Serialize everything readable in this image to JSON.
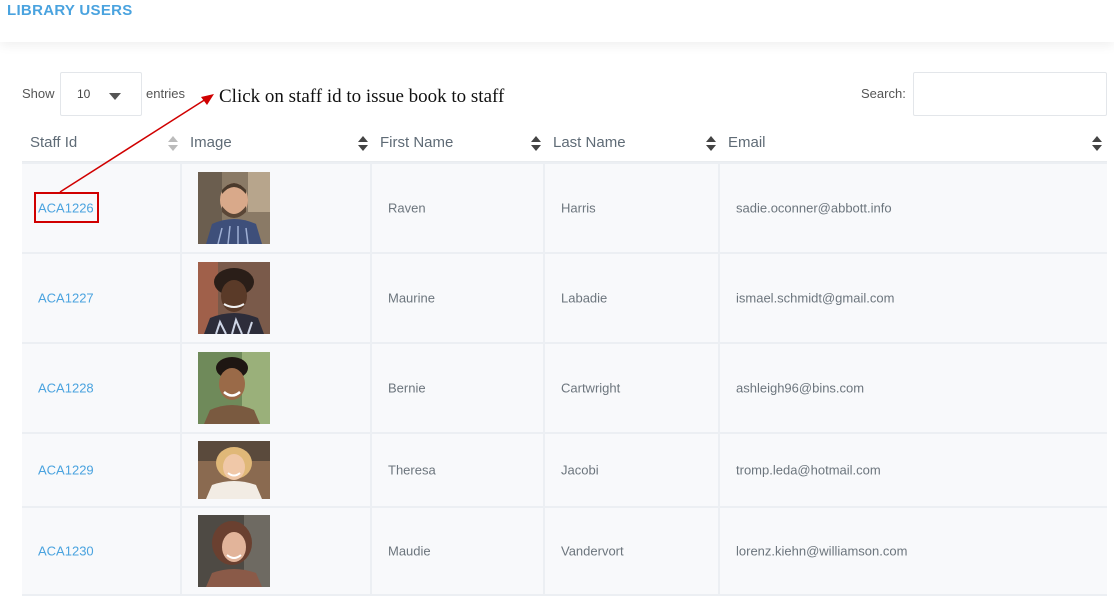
{
  "page": {
    "title": "LIBRARY USERS"
  },
  "table_controls": {
    "show_label": "Show",
    "entries_value": "10",
    "entries_label": "entries",
    "search_label": "Search:",
    "search_value": ""
  },
  "annotation": {
    "text": "Click on staff id to issue book to staff",
    "color": "#d00000"
  },
  "table": {
    "columns": [
      {
        "label": "Staff Id"
      },
      {
        "label": "Image"
      },
      {
        "label": "First Name"
      },
      {
        "label": "Last Name"
      },
      {
        "label": "Email"
      }
    ],
    "rows": [
      {
        "staff_id": "ACA1226",
        "avatar": "man-beard-plaid-shirt",
        "first_name": "Raven",
        "last_name": "Harris",
        "email": "sadie.oconner@abbott.info"
      },
      {
        "staff_id": "ACA1227",
        "avatar": "woman-curly-hair",
        "first_name": "Maurine",
        "last_name": "Labadie",
        "email": "ismael.schmidt@gmail.com"
      },
      {
        "staff_id": "ACA1228",
        "avatar": "young-man-smiling",
        "first_name": "Bernie",
        "last_name": "Cartwright",
        "email": "ashleigh96@bins.com"
      },
      {
        "staff_id": "ACA1229",
        "avatar": "blonde-woman-smiling",
        "first_name": "Theresa",
        "last_name": "Jacobi",
        "email": "tromp.leda@hotmail.com"
      },
      {
        "staff_id": "ACA1230",
        "avatar": "woman-brown-hair",
        "first_name": "Maudie",
        "last_name": "Vandervort",
        "email": "lorenz.kiehn@williamson.com"
      }
    ]
  },
  "colors": {
    "accent": "#4aa3df",
    "annotation": "#d00000"
  }
}
